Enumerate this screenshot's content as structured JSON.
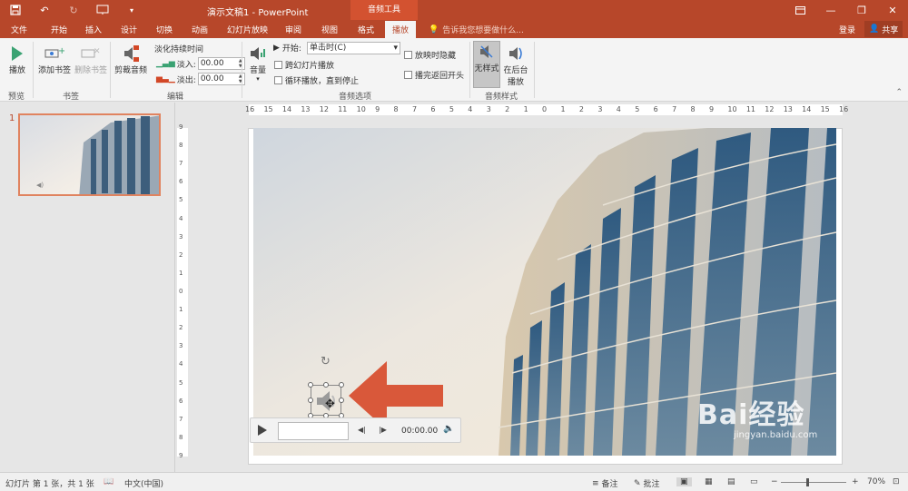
{
  "app": {
    "doc_title": "演示文稿1 - PowerPoint",
    "tool_context": "音频工具",
    "accent": "#b7472a"
  },
  "qat": {
    "icons": [
      "save-icon",
      "undo-icon",
      "redo-icon",
      "present-icon",
      "customize-icon"
    ]
  },
  "tabs": [
    "文件",
    "开始",
    "插入",
    "设计",
    "切换",
    "动画",
    "幻灯片放映",
    "审阅",
    "视图",
    "格式",
    "播放"
  ],
  "tell_me": "告诉我您想要做什么...",
  "account": {
    "login": "登录",
    "share": "共享"
  },
  "ribbon": {
    "preview": {
      "play": "播放",
      "group": "预览"
    },
    "bookmarks": {
      "add": "添加书签",
      "remove": "删除书签",
      "group": "书签"
    },
    "editing": {
      "trim": "剪裁音频",
      "fade_title": "淡化持续时间",
      "fade_in_label": "淡入:",
      "fade_in_value": "00.00",
      "fade_out_label": "淡出:",
      "fade_out_value": "00.00",
      "group": "编辑"
    },
    "audio_options": {
      "volume": "音量",
      "start_label": "开始:",
      "start_value": "单击时(C)",
      "across_slides": "跨幻灯片播放",
      "loop": "循环播放，直到停止",
      "hide": "放映时隐藏",
      "rewind": "播完返回开头",
      "group": "音频选项"
    },
    "audio_styles": {
      "none": "无样式",
      "bg": "在后台播放",
      "group": "音频样式"
    }
  },
  "thumbnails": {
    "slide_number": "1"
  },
  "ruler_labels": [
    "16",
    "15",
    "14",
    "13",
    "12",
    "11",
    "10",
    "9",
    "8",
    "7",
    "6",
    "5",
    "4",
    "3",
    "2",
    "1",
    "0",
    "1",
    "2",
    "3",
    "4",
    "5",
    "6",
    "7",
    "8",
    "9",
    "10",
    "11",
    "12",
    "13",
    "14",
    "15",
    "16"
  ],
  "vruler_labels": [
    "9",
    "8",
    "7",
    "6",
    "5",
    "4",
    "3",
    "2",
    "1",
    "0",
    "1",
    "2",
    "3",
    "4",
    "5",
    "6",
    "7",
    "8",
    "9"
  ],
  "player": {
    "time": "00:00.00"
  },
  "status": {
    "slide_info": "幻灯片 第 1 张，共 1 张",
    "language": "中文(中国)",
    "notes": "备注",
    "comments": "批注",
    "zoom": "70%"
  },
  "watermark": {
    "main": "Bai经验",
    "sub": "jingyan.baidu.com"
  }
}
